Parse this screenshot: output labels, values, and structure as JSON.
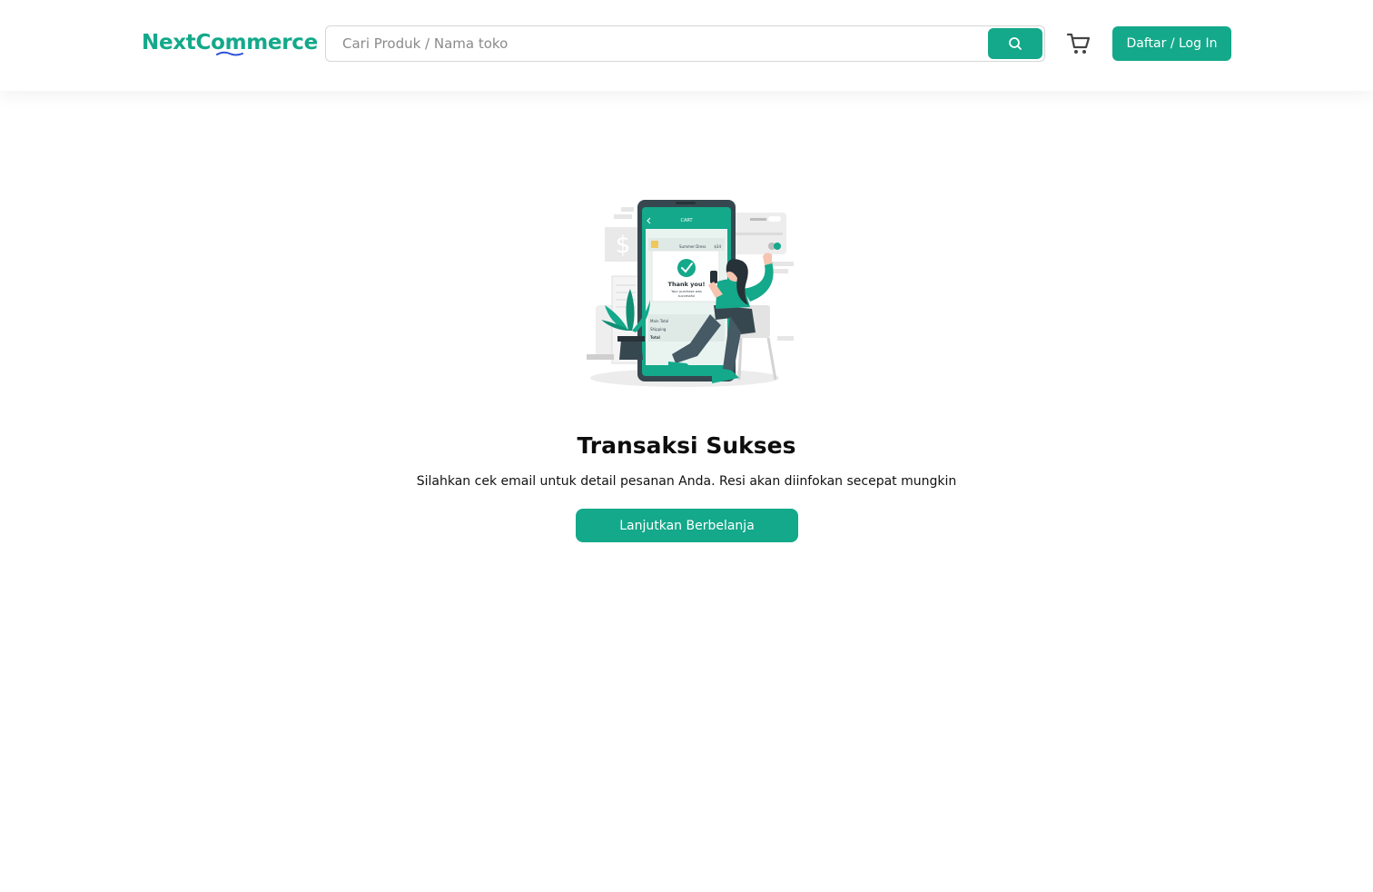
{
  "header": {
    "logo": {
      "part1": "Next",
      "part2": "Commerce"
    },
    "search": {
      "placeholder": "Cari Produk / Nama toko",
      "value": ""
    },
    "search_icon": "search-icon",
    "cart_icon": "cart-icon",
    "login_label": "Daftar / Log In"
  },
  "main": {
    "illustration": {
      "phone_header": "CART",
      "dialog_title": "Thank you!",
      "dialog_text_1": "Your purchase was",
      "dialog_text_2": "successful",
      "list_item": "Summer Dress",
      "price": "$34",
      "row_1": "Main Total",
      "row_2": "Shipping",
      "row_3": "Total",
      "dollar_sign": "$"
    },
    "title": "Transaksi Sukses",
    "subtitle": "Silahkan cek email untuk detail pesanan Anda. Resi akan diinfokan secepat mungkin",
    "continue_label": "Lanjutkan Berbelanja"
  },
  "colors": {
    "accent": "#13a98a",
    "dark": "#37474f"
  }
}
